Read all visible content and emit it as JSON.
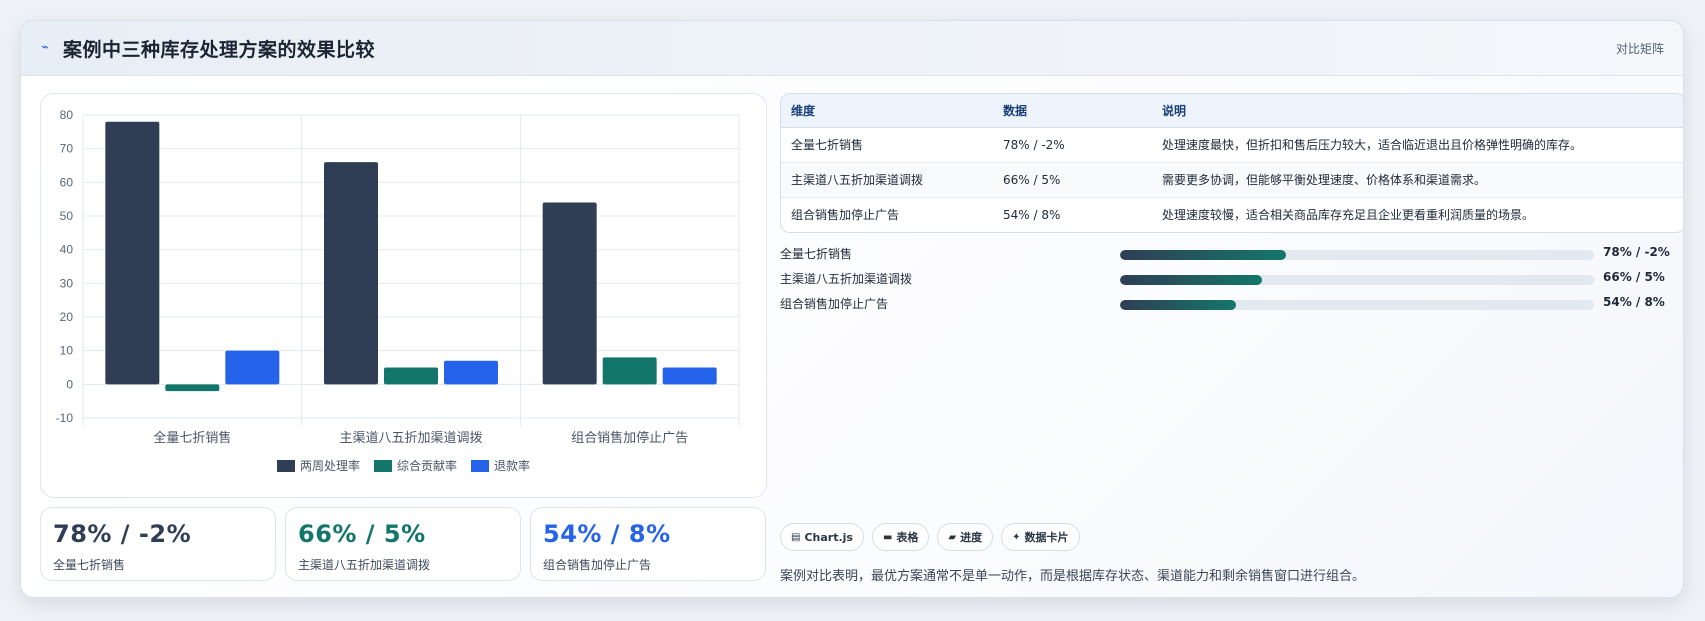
{
  "header": {
    "icon": "trend-line-icon",
    "title": "案例中三种库存处理方案的效果比较",
    "tag": "对比矩阵"
  },
  "chart_data": {
    "type": "bar",
    "categories": [
      "全量七折销售",
      "主渠道八五折加渠道调拨",
      "组合销售加停止广告"
    ],
    "series": [
      {
        "name": "两周处理率",
        "values": [
          78,
          66,
          54
        ],
        "color": "#2f3e55"
      },
      {
        "name": "综合贡献率",
        "values": [
          -2,
          5,
          8
        ],
        "color": "#13766a"
      },
      {
        "name": "退款率",
        "values": [
          10,
          7,
          5
        ],
        "color": "#2563eb"
      }
    ],
    "ylim": [
      -10,
      80
    ],
    "yticks": [
      -10,
      0,
      10,
      20,
      30,
      40,
      50,
      60,
      70,
      80
    ],
    "grid": true,
    "legend": "bottom"
  },
  "stats": [
    {
      "value": "78% / -2%",
      "label": "全量七折销售",
      "color": "#2f3e55"
    },
    {
      "value": "66% / 5%",
      "label": "主渠道八五折加渠道调拨",
      "color": "#13766a"
    },
    {
      "value": "54% / 8%",
      "label": "组合销售加停止广告",
      "color": "#2563eb"
    }
  ],
  "table": {
    "headers": [
      "维度",
      "数据",
      "说明"
    ],
    "rows": [
      [
        "全量七折销售",
        "78% / -2%",
        "处理速度最快，但折扣和售后压力较大，适合临近退出且价格弹性明确的库存。"
      ],
      [
        "主渠道八五折加渠道调拨",
        "66% / 5%",
        "需要更多协调，但能够平衡处理速度、价格体系和渠道需求。"
      ],
      [
        "组合销售加停止广告",
        "54% / 8%",
        "处理速度较慢，适合相关商品库存充足且企业更看重利润质量的场景。"
      ]
    ]
  },
  "progress": [
    {
      "label": "全量七折销售",
      "value": "78% / -2%",
      "level": 0.35
    },
    {
      "label": "主渠道八五折加渠道调拨",
      "value": "66% / 5%",
      "level": 0.3
    },
    {
      "label": "组合销售加停止广告",
      "value": "54% / 8%",
      "level": 0.245
    }
  ],
  "chips": [
    {
      "icon": "chart-icon",
      "glyph": "▤",
      "label": "Chart.js"
    },
    {
      "icon": "table-icon",
      "glyph": "▬",
      "label": "表格"
    },
    {
      "icon": "progress-icon",
      "glyph": "▰",
      "label": "进度"
    },
    {
      "icon": "sparkle-icon",
      "glyph": "✦",
      "label": "数据卡片"
    }
  ],
  "conclusion": "案例对比表明，最优方案通常不是单一动作，而是根据库存状态、渠道能力和剩余销售窗口进行组合。"
}
